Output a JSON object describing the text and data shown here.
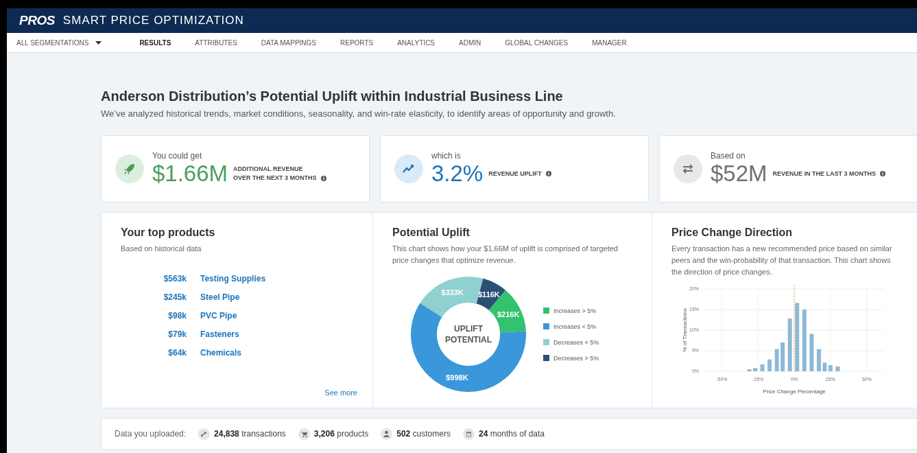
{
  "header": {
    "logo": "PROS",
    "title": "SMART PRICE OPTIMIZATION"
  },
  "nav": {
    "dropdown": "ALL SEGMENTATIONS",
    "items": [
      {
        "label": "RESULTS",
        "selected": true
      },
      {
        "label": "ATTRIBUTES",
        "selected": false
      },
      {
        "label": "DATA MAPPINGS",
        "selected": false
      },
      {
        "label": "REPORTS",
        "selected": false
      },
      {
        "label": "ANALYTICS",
        "selected": false
      },
      {
        "label": "ADMIN",
        "selected": false
      },
      {
        "label": "GLOBAL CHANGES",
        "selected": false
      },
      {
        "label": "MANAGER",
        "selected": false
      }
    ]
  },
  "page": {
    "title": "Anderson Distribution’s Potential Uplift within Industrial Business Line",
    "subtitle": "We’ve analyzed historical trends, market conditions, seasonality, and win-rate elasticity, to identify areas of opportunity and growth."
  },
  "kpis": [
    {
      "kind": "rocket",
      "color": "#4a9e5c",
      "caption": "You could get",
      "value": "$1.66M",
      "label_lines": [
        "ADDITIONAL REVENUE",
        "OVER THE NEXT 3 MONTHS"
      ]
    },
    {
      "kind": "trend",
      "color": "#1b75bb",
      "caption": "which is",
      "value": "3.2%",
      "label_lines": [
        "REVENUE UPLIFT"
      ]
    },
    {
      "kind": "exchange",
      "color": "#707070",
      "caption": "Based on",
      "value": "$52M",
      "label_lines": [
        "REVENUE IN THE LAST 3 MONTHS"
      ]
    }
  ],
  "top_products": {
    "title": "Your top products",
    "subtitle": "Based on historical data",
    "rows": [
      {
        "amount": "$563k",
        "name": "Testing Supplies"
      },
      {
        "amount": "$245k",
        "name": "Steel Pipe"
      },
      {
        "amount": "$98k",
        "name": "PVC Pipe"
      },
      {
        "amount": "$79k",
        "name": "Fasteners"
      },
      {
        "amount": "$64k",
        "name": "Chemicals"
      }
    ],
    "link": "See more"
  },
  "potential_uplift": {
    "title": "Potential Uplift",
    "description": "This chart shows how your $1.66M of uplift is comprised of targeted price changes that optimize revenue.",
    "center_label_lines": [
      "UPLIFT",
      "POTENTIAL"
    ],
    "chart_data": {
      "type": "donut",
      "categories": [
        "Increases > 5%",
        "Increases < 5%",
        "Decreases < 5%",
        "Decreases > 5%"
      ],
      "series": [
        {
          "values": [
            13,
            60,
            20,
            7
          ]
        }
      ],
      "legend": true,
      "colors": [
        "#33c26e",
        "#3a97d9",
        "#8fd0d0",
        "#2d4f73"
      ],
      "value_labels": [
        "$216K",
        "$998K",
        "$333K",
        "$116K"
      ]
    }
  },
  "price_change": {
    "title": "Price Change Direction",
    "description": "Every transaction has a new recommended price based on similar peers and the win-probability of that transaction. This chart shows the direction of price changes.",
    "chart_data": {
      "type": "bar",
      "xlabel": "Price Change Percentage",
      "ylabel": "% of Transactions",
      "x": [
        -31,
        -27,
        -22,
        -17,
        -12,
        -8,
        -3,
        2,
        7,
        12,
        17,
        21,
        25,
        30
      ],
      "grid": true,
      "ref_lines": [
        {
          "axis": "x",
          "value": 0,
          "color": "#f5a623"
        }
      ],
      "series": [
        {
          "color": "#8db9d6",
          "values": [
            0.5,
            0.8,
            1.7,
            2.9,
            5.4,
            7,
            12.8,
            16.6,
            15,
            9.1,
            5.4,
            2.1,
            1.5,
            1.2
          ]
        }
      ],
      "xlim": [
        -62,
        62
      ],
      "ylim": [
        0,
        20
      ],
      "xticks": [
        {
          "value": -50,
          "label": "-50%"
        },
        {
          "value": -25,
          "label": "-25%"
        },
        {
          "value": 0,
          "label": "0%"
        },
        {
          "value": 25,
          "label": "25%"
        },
        {
          "value": 50,
          "label": "50%"
        }
      ],
      "yticks": [
        {
          "value": 0,
          "label": "0%"
        },
        {
          "value": 5,
          "label": "5%"
        },
        {
          "value": 10,
          "label": "10%"
        },
        {
          "value": 15,
          "label": "15%"
        },
        {
          "value": 20,
          "label": "20%"
        }
      ]
    }
  },
  "data_uploaded": {
    "label": "Data you uploaded:",
    "items": [
      {
        "kind": "transactions",
        "text": "**24,838** transactions"
      },
      {
        "kind": "products",
        "text": "**3,206** products"
      },
      {
        "kind": "customers",
        "text": "**502** customers"
      },
      {
        "kind": "months",
        "text": "**24** months of data"
      }
    ]
  }
}
